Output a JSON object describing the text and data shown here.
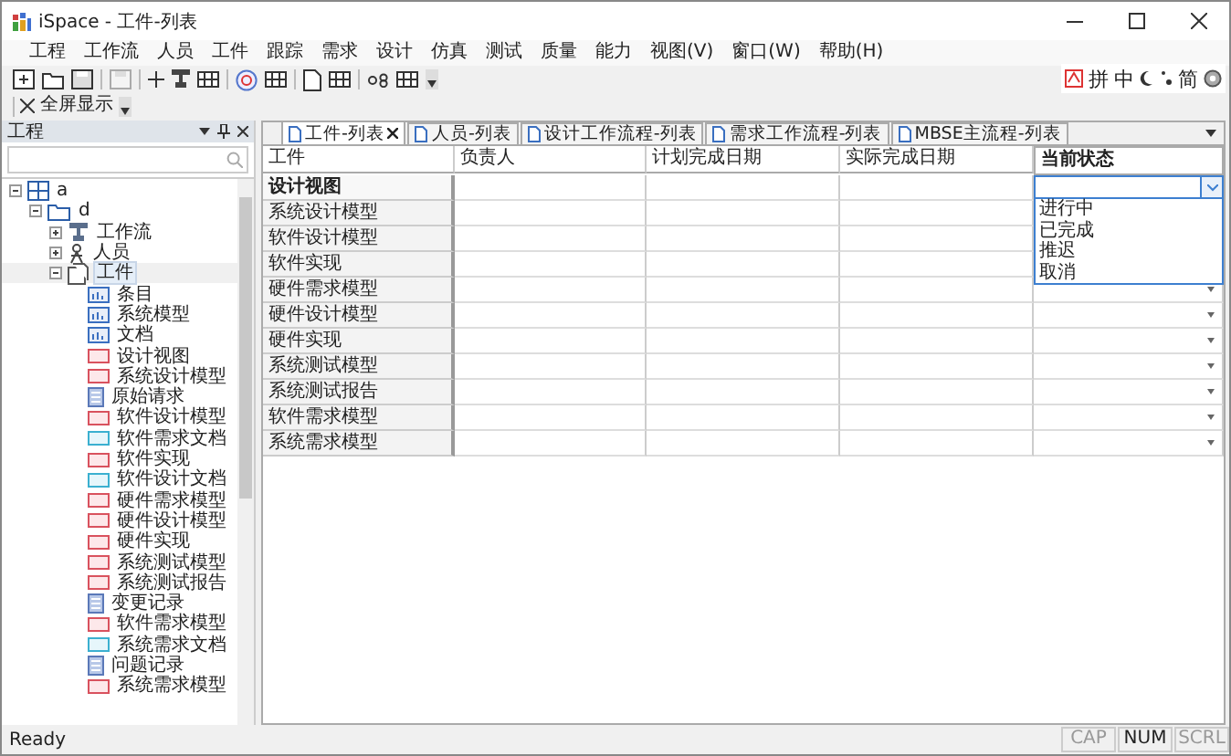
{
  "window": {
    "title": "iSpace - 工件-列表"
  },
  "menu": [
    "工程",
    "工作流",
    "人员",
    "工件",
    "跟踪",
    "需求",
    "设计",
    "仿真",
    "测试",
    "质量",
    "能力",
    "视图(V)",
    "窗口(W)",
    "帮助(H)"
  ],
  "ime": [
    "拼",
    "中",
    "简"
  ],
  "toolbar2": {
    "button": "全屏显示"
  },
  "panel": {
    "title": "工程",
    "tree": [
      {
        "label": "a",
        "kind": "grid",
        "expanded": true,
        "selected": false,
        "children": [
          {
            "label": "d",
            "kind": "folder",
            "expanded": true,
            "selected": false,
            "children": [
              {
                "label": "工作流",
                "kind": "flow",
                "expanded": false,
                "selected": false
              },
              {
                "label": "人员",
                "kind": "person",
                "expanded": false,
                "selected": false
              },
              {
                "label": "工件",
                "kind": "artifact",
                "expanded": true,
                "selected": true,
                "children": [
                  {
                    "label": "条目",
                    "kind": "chart",
                    "selected": false
                  },
                  {
                    "label": "系统模型",
                    "kind": "chart",
                    "selected": false
                  },
                  {
                    "label": "文档",
                    "kind": "chart",
                    "selected": false
                  },
                  {
                    "label": "设计视图",
                    "kind": "model",
                    "selected": false
                  },
                  {
                    "label": "系统设计模型",
                    "kind": "model",
                    "selected": false
                  },
                  {
                    "label": "原始请求",
                    "kind": "form",
                    "selected": false
                  },
                  {
                    "label": "软件设计模型",
                    "kind": "model",
                    "selected": false
                  },
                  {
                    "label": "软件需求文档",
                    "kind": "doc",
                    "selected": false
                  },
                  {
                    "label": "软件实现",
                    "kind": "model",
                    "selected": false
                  },
                  {
                    "label": "软件设计文档",
                    "kind": "doc",
                    "selected": false
                  },
                  {
                    "label": "硬件需求模型",
                    "kind": "model",
                    "selected": false
                  },
                  {
                    "label": "硬件设计模型",
                    "kind": "model",
                    "selected": false
                  },
                  {
                    "label": "硬件实现",
                    "kind": "model",
                    "selected": false
                  },
                  {
                    "label": "系统测试模型",
                    "kind": "model",
                    "selected": false
                  },
                  {
                    "label": "系统测试报告",
                    "kind": "model",
                    "selected": false
                  },
                  {
                    "label": "变更记录",
                    "kind": "form",
                    "selected": false
                  },
                  {
                    "label": "软件需求模型",
                    "kind": "model",
                    "selected": false
                  },
                  {
                    "label": "系统需求文档",
                    "kind": "doc",
                    "selected": false
                  },
                  {
                    "label": "问题记录",
                    "kind": "form",
                    "selected": false
                  },
                  {
                    "label": "系统需求模型",
                    "kind": "model",
                    "selected": false
                  }
                ]
              }
            ]
          }
        ]
      }
    ]
  },
  "tabs": [
    {
      "label": "工件-列表",
      "selected": true,
      "closable": true
    },
    {
      "label": "人员-列表",
      "selected": false
    },
    {
      "label": "设计工作流程-列表",
      "selected": false
    },
    {
      "label": "需求工作流程-列表",
      "selected": false
    },
    {
      "label": "MBSE主流程-列表",
      "selected": false
    }
  ],
  "table": {
    "columns": [
      "工件",
      "负责人",
      "计划完成日期",
      "实际完成日期",
      "当前状态"
    ],
    "rows": [
      {
        "name": "设计视图",
        "selected": true,
        "status_dropdown": {
          "options": [
            "进行中",
            "已完成",
            "推迟",
            "取消"
          ]
        }
      },
      {
        "name": "系统设计模型",
        "selected": false
      },
      {
        "name": "软件设计模型",
        "selected": false
      },
      {
        "name": "软件实现",
        "selected": false
      },
      {
        "name": "硬件需求模型",
        "selected": false
      },
      {
        "name": "硬件设计模型",
        "selected": false
      },
      {
        "name": "硬件实现",
        "selected": false
      },
      {
        "name": "系统测试模型",
        "selected": false
      },
      {
        "name": "系统测试报告",
        "selected": false
      },
      {
        "name": "软件需求模型",
        "selected": false
      },
      {
        "name": "系统需求模型",
        "selected": false
      }
    ]
  },
  "status_bar": {
    "text": "Ready",
    "indicators": [
      {
        "label": "CAP",
        "on": false
      },
      {
        "label": "NUM",
        "on": true
      },
      {
        "label": "SCRL",
        "on": false
      }
    ]
  }
}
